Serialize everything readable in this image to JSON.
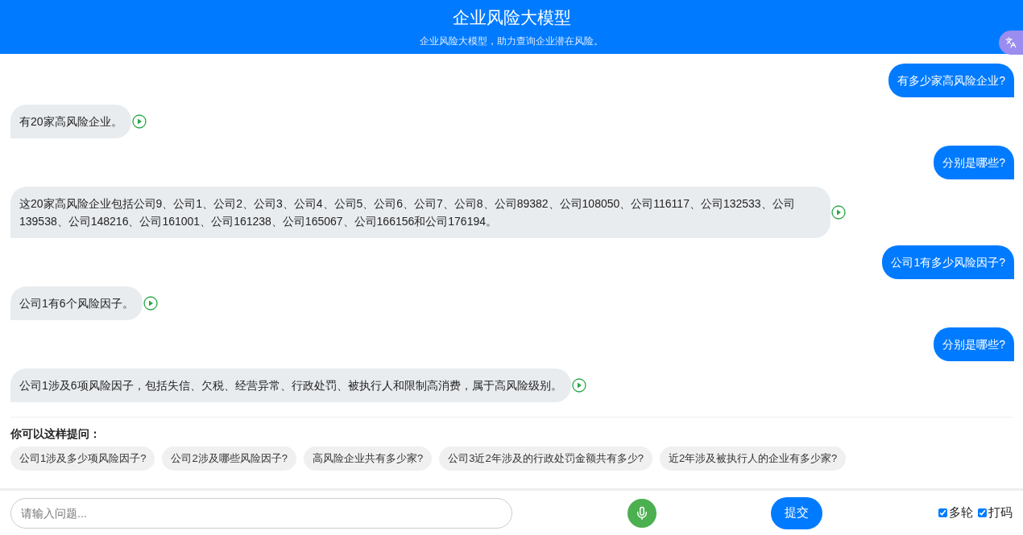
{
  "header": {
    "title": "企业风险大模型",
    "subtitle": "企业风险大模型，助力查询企业潜在风险。"
  },
  "messages": [
    {
      "kind": "user",
      "text": "有多少家高风险企业?"
    },
    {
      "kind": "bot",
      "text": "有20家高风险企业。"
    },
    {
      "kind": "user",
      "text": "分别是哪些?"
    },
    {
      "kind": "bot",
      "text": "这20家高风险企业包括公司9、公司1、公司2、公司3、公司4、公司5、公司6、公司7、公司8、公司89382、公司108050、公司116117、公司132533、公司139538、公司148216、公司161001、公司161238、公司165067、公司166156和公司176194。"
    },
    {
      "kind": "user",
      "text": "公司1有多少风险因子?"
    },
    {
      "kind": "bot",
      "text": "公司1有6个风险因子。"
    },
    {
      "kind": "user",
      "text": "分别是哪些?"
    },
    {
      "kind": "bot",
      "text": "公司1涉及6项风险因子，包括失信、欠税、经营异常、行政处罚、被执行人和限制高消费，属于高风险级别。"
    }
  ],
  "suggestions": {
    "title": "你可以这样提问：",
    "items": [
      "公司1涉及多少项风险因子?",
      "公司2涉及哪些风险因子?",
      "高风险企业共有多少家?",
      "公司3近2年涉及的行政处罚金额共有多少?",
      "近2年涉及被执行人的企业有多少家?"
    ]
  },
  "input": {
    "placeholder": "请输入问题..."
  },
  "submit": "提交",
  "options": [
    {
      "label": "多轮",
      "checked": true
    },
    {
      "label": "打码",
      "checked": true
    }
  ]
}
